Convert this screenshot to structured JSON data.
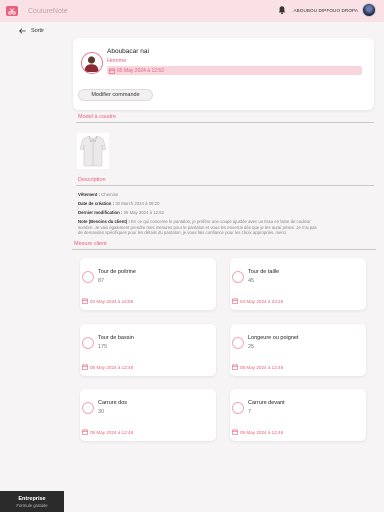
{
  "topbar": {
    "app_name": "CoutureNote",
    "username": "ABOUBOU DIPFOUO DROPA",
    "logo_icon": "scissors-icon",
    "bell_icon": "bell-icon"
  },
  "nav": {
    "back_label": "Sortir",
    "back_icon": "arrow-left-icon"
  },
  "client": {
    "name": "Aboubacar nai",
    "gender": "Homme",
    "date": "05 May 2024 à 12:52",
    "modify_label": "Modifier commande"
  },
  "model_section": {
    "title": "Model à coudre"
  },
  "description": {
    "title": "Description",
    "garment_label": "Vêtement :",
    "garment_value": "Chemise",
    "created_label": "Date de création :",
    "created_value": "30 March 2024 à 08:20",
    "modified_label": "Dernier modification :",
    "modified_value": "05 May 2024 à 12:52",
    "note_label": "Note (Besoins du client) :",
    "note_line1": "En ce qui concerne le pantalon, je préfère une coupe ajustée avec un tissu en laine de couleur",
    "note_line2": "sombre. Je vais également prendre mes mesures pour le pantalon et vous les enverrai dès que je les aurai prises. Je n'ai pas",
    "note_line3": "de demandes spécifiques pour les détails du pantalon, je vous fais confiance pour les choix appropriés. merci"
  },
  "measures": {
    "title": "Mesure client",
    "items": [
      {
        "label": "Tour de poitrine",
        "value": "87",
        "date": "03 May 2024 à 16:58"
      },
      {
        "label": "Tour de taille",
        "value": "45",
        "date": "04 May 2024 à 23:25"
      },
      {
        "label": "Tour de bassin",
        "value": "175",
        "date": "05 May 2024 à 12:48"
      },
      {
        "label": "Longeure ou poignet",
        "value": "25",
        "date": "05 May 2024 à 12:48"
      },
      {
        "label": "Carrure dos",
        "value": "30",
        "date": "05 May 2024 à 12:48"
      },
      {
        "label": "Carrure devant",
        "value": "7",
        "date": "05 May 2024 à 12:48"
      }
    ]
  },
  "footer": {
    "plan": "Entreprise",
    "subtitle": "Formule gratuite"
  },
  "colors": {
    "accent": "#e8607b",
    "topbar": "#f9e1e6",
    "pill": "#f9d5dd"
  }
}
